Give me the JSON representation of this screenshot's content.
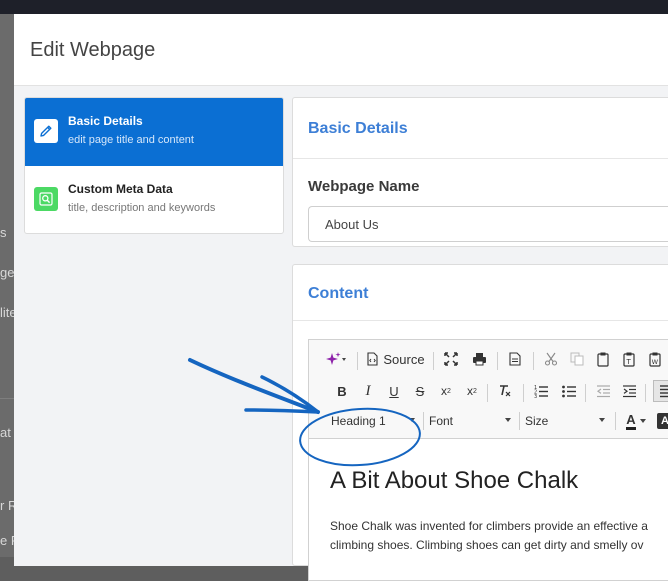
{
  "background": {
    "fragments": [
      "s",
      "ge",
      "lite",
      "at",
      "r R",
      "e F"
    ]
  },
  "modal": {
    "title": "Edit Webpage"
  },
  "nav": {
    "items": [
      {
        "title": "Basic Details",
        "subtitle": "edit page title and content",
        "icon": "pencil-icon",
        "active": true
      },
      {
        "title": "Custom Meta Data",
        "subtitle": "title, description and keywords",
        "icon": "search-icon",
        "active": false
      }
    ]
  },
  "basic_details": {
    "title": "Basic Details",
    "webpage_name_label": "Webpage Name",
    "webpage_name_value": "About Us"
  },
  "content": {
    "title": "Content",
    "toolbar": {
      "source_label": "Source",
      "format_value": "Heading 1",
      "font_value": "Font",
      "size_value": "Size",
      "text_color_label": "A",
      "bg_color_label": "A"
    },
    "heading": "A Bit About Shoe Chalk",
    "paragraph_line1": "Shoe Chalk was invented for climbers provide an effective a",
    "paragraph_line2": "climbing shoes. Climbing shoes can get dirty and smelly ov"
  },
  "colors": {
    "accent": "#0b6fd3",
    "title_blue": "#3d7fd6",
    "annotation": "#1565c0",
    "meta_icon_green": "#4cd964"
  }
}
